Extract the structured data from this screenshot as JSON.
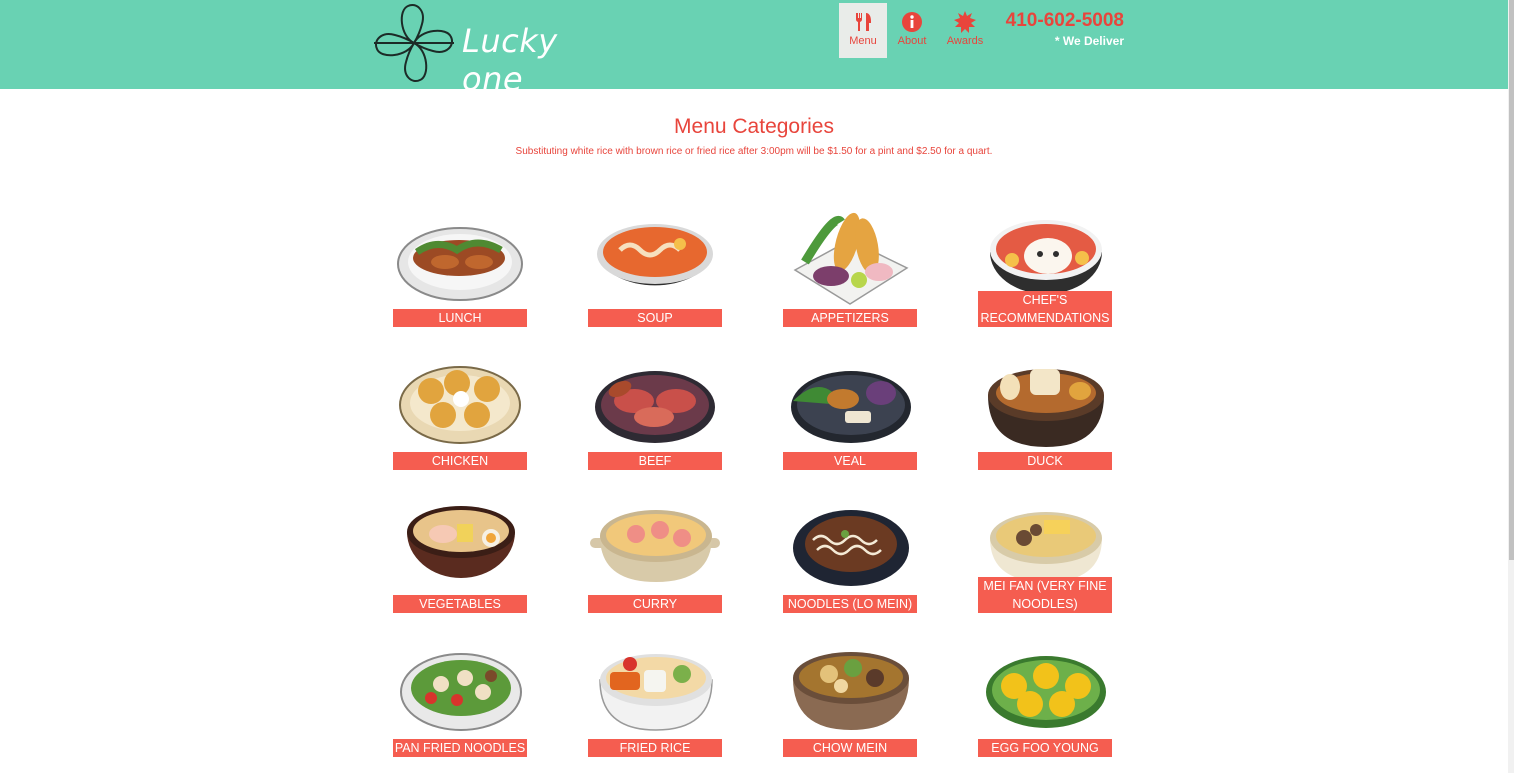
{
  "brand": {
    "name": "Lucky one"
  },
  "nav": {
    "items": [
      {
        "label": "Menu",
        "icon": "utensils-icon"
      },
      {
        "label": "About",
        "icon": "info-icon"
      },
      {
        "label": "Awards",
        "icon": "award-icon"
      }
    ]
  },
  "contact": {
    "phone": "410-602-5008",
    "note": "* We Deliver"
  },
  "page": {
    "title": "Menu Categories",
    "note": "Substituting white rice with brown rice or fried rice after 3:00pm will be $1.50 for a pint and $2.50 for a quart."
  },
  "categories": [
    {
      "label": "Lunch",
      "icon": "lunch-plate-icon"
    },
    {
      "label": "Soup",
      "icon": "soup-bowl-icon"
    },
    {
      "label": "Appetizers",
      "icon": "tempura-icon"
    },
    {
      "label": "Chef's Recommendations",
      "icon": "chef-bowl-icon"
    },
    {
      "label": "Chicken",
      "icon": "chicken-plate-icon"
    },
    {
      "label": "Beef",
      "icon": "beef-plate-icon"
    },
    {
      "label": "Veal",
      "icon": "veal-plate-icon"
    },
    {
      "label": "Duck",
      "icon": "duck-pot-icon"
    },
    {
      "label": "Vegetables",
      "icon": "ramen-bowl-icon"
    },
    {
      "label": "Curry",
      "icon": "curry-pot-icon"
    },
    {
      "label": "Noodles (Lo Mein)",
      "icon": "noodle-plate-icon"
    },
    {
      "label": "Mei Fan (very fine noodles)",
      "icon": "mei-fan-bowl-icon"
    },
    {
      "label": "Pan Fried Noodles",
      "icon": "pan-fried-noodle-icon"
    },
    {
      "label": "Fried Rice",
      "icon": "fried-rice-bowl-icon"
    },
    {
      "label": "Chow Mein",
      "icon": "chow-mein-bowl-icon"
    },
    {
      "label": "Egg Foo Young",
      "icon": "egg-foo-young-icon"
    }
  ],
  "colors": {
    "header_bg": "#69d2b3",
    "accent": "#e8453c",
    "label_bg": "#f55d50",
    "nav_active_bg": "#e9ece9"
  }
}
